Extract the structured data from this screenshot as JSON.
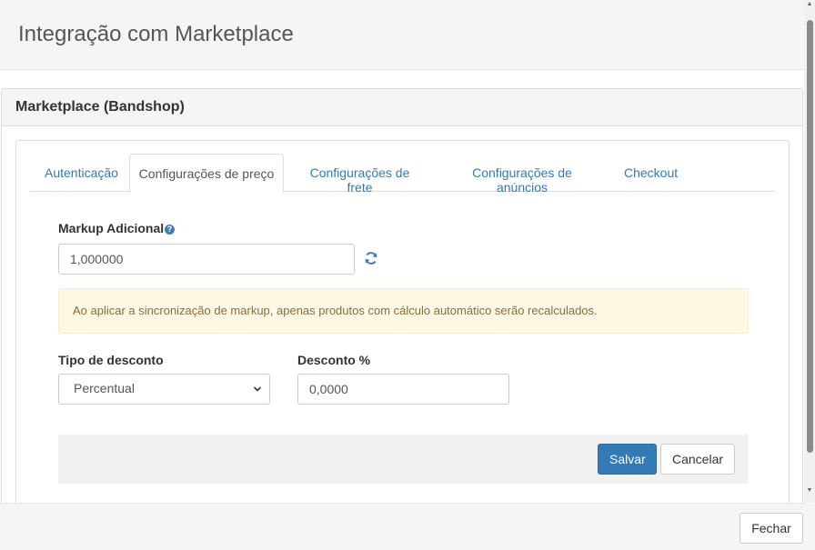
{
  "modal": {
    "title": "Integração com Marketplace",
    "close_label": "Fechar"
  },
  "panel": {
    "title": "Marketplace (Bandshop)"
  },
  "tabs": [
    {
      "label": "Autenticação",
      "active": false
    },
    {
      "label": "Configurações de preço",
      "active": true
    },
    {
      "label": "Configurações de frete",
      "active": false
    },
    {
      "label": "Configurações de anúncios",
      "active": false
    },
    {
      "label": "Checkout",
      "active": false
    }
  ],
  "markup": {
    "label": "Markup Adicional",
    "value": "1,000000"
  },
  "alert": {
    "text": "Ao aplicar a sincronização de markup, apenas produtos com cálculo automático serão recalculados."
  },
  "discount_type": {
    "label": "Tipo de desconto",
    "selected": "Percentual"
  },
  "discount_percent": {
    "label": "Desconto %",
    "value": "0,0000"
  },
  "actions": {
    "save_label": "Salvar",
    "cancel_label": "Cancelar"
  },
  "colors": {
    "primary": "#337ab7",
    "alert_bg": "#fcf8e3",
    "alert_text": "#8a6d3b"
  },
  "icons": {
    "help": "question-circle-icon",
    "refresh": "refresh-icon",
    "select": "chevron-down-icon"
  }
}
